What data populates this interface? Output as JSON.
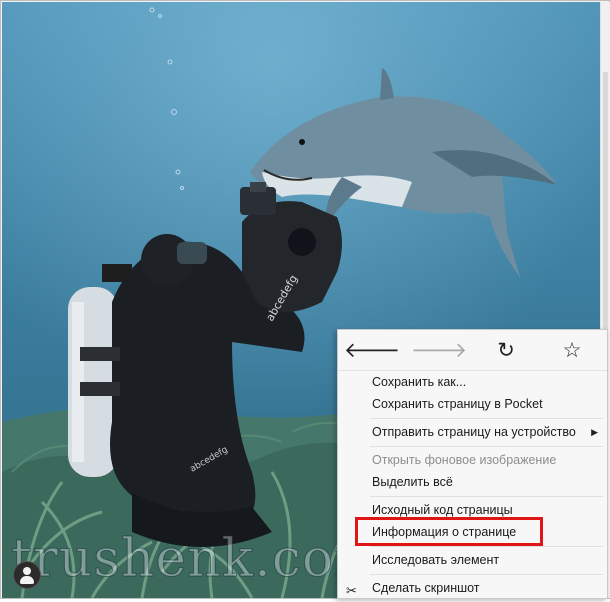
{
  "window": {
    "watermark_text": "trushenk.com"
  },
  "photo": {
    "scene": "underwater",
    "camera_brand_text": "abcedefg"
  },
  "context_menu": {
    "nav": {
      "back_icon": "arrow-left-icon",
      "forward_icon": "arrow-right-icon",
      "reload_icon": "reload-icon",
      "bookmark_icon": "star-icon",
      "back_glyph": "🡐",
      "forward_glyph": "🡒",
      "reload_glyph": "↻",
      "bookmark_glyph": "☆"
    },
    "items": [
      {
        "label": "Сохранить как...",
        "enabled": true
      },
      {
        "label": "Сохранить страницу в Pocket",
        "enabled": true
      },
      {
        "label": "Отправить страницу на устройство",
        "enabled": true,
        "submenu": true
      },
      {
        "label": "Открыть фоновое изображение",
        "enabled": false
      },
      {
        "label": "Выделить всё",
        "enabled": true
      },
      {
        "label": "Исходный код страницы",
        "enabled": true
      },
      {
        "label": "Информация о странице",
        "enabled": true,
        "highlighted": true
      },
      {
        "label": "Исследовать элемент",
        "enabled": true
      },
      {
        "label": "Сделать скриншот",
        "enabled": true,
        "icon": "screenshot-scissors-icon"
      }
    ],
    "submenu_arrow": "▶",
    "screenshot_glyph": "✂"
  },
  "colors": {
    "highlight_border": "#e01515",
    "water": "#3f7e9e",
    "menu_bg": "#f7f7f7"
  }
}
